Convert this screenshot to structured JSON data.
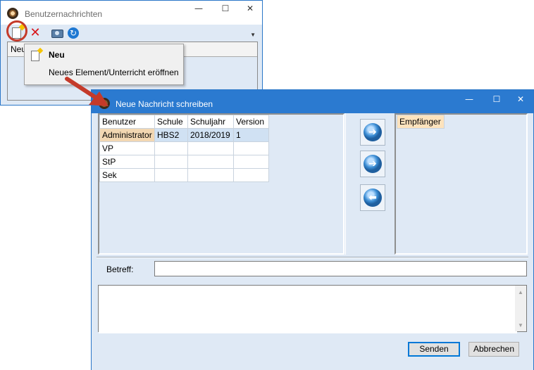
{
  "window1": {
    "title": "Benutzernachrichten",
    "controls": {
      "minimize": "—",
      "maximize": "☐",
      "close": "✕"
    },
    "toolbar": {
      "new_icon": "new-document-icon",
      "delete_icon": "red-x-icon",
      "camera_icon": "camera-icon",
      "refresh_icon": "refresh-icon",
      "dropdown": "▼"
    },
    "grid_header_first": "Neu"
  },
  "popup": {
    "title": "Neu",
    "description": "Neues Element/Unterricht eröffnen"
  },
  "window2": {
    "title": "Neue Nachricht schreiben",
    "controls": {
      "minimize": "—",
      "maximize": "☐",
      "close": "✕"
    },
    "users_table": {
      "headers": [
        "Benutzer",
        "Schule",
        "Schuljahr",
        "Version"
      ],
      "rows": [
        [
          "Administrator",
          "HBS2",
          "2018/2019",
          "1"
        ],
        [
          "VP",
          "",
          "",
          ""
        ],
        [
          "StP",
          "",
          "",
          ""
        ],
        [
          "Sek",
          "",
          "",
          ""
        ]
      ]
    },
    "arrow_buttons": {
      "add": "➔",
      "add_all": "➔",
      "remove": "⬅"
    },
    "recipients_header": "Empfänger",
    "subject_label": "Betreff:",
    "subject_value": "",
    "message_value": "",
    "scroll": {
      "up": "▲",
      "down": "▼"
    },
    "send_button": "Senden",
    "cancel_button": "Abbrechen"
  },
  "colors": {
    "accent": "#2b7ad0",
    "highlight": "#fde3bd",
    "annotation": "#c43a2a"
  }
}
